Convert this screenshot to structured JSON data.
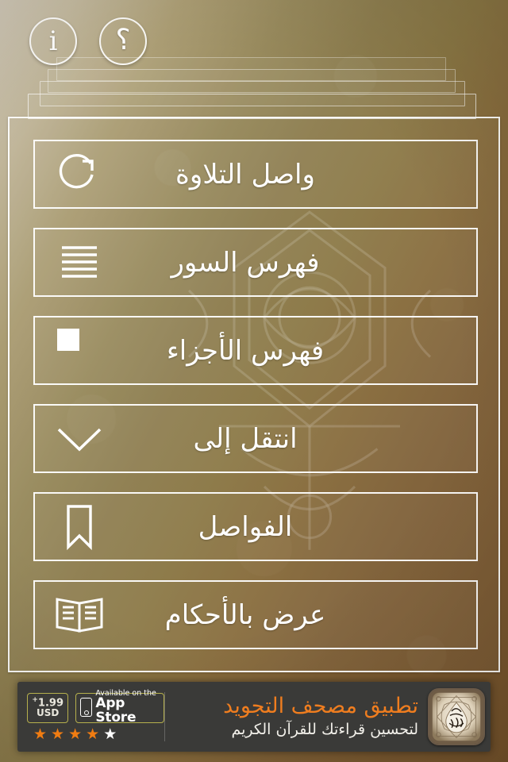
{
  "app": {
    "title": "مصحف التجويد",
    "accent_gold": "#8a7744",
    "accent_brown": "#75532b",
    "panel_border": "#ffffff"
  },
  "header": {
    "buttons": [
      {
        "id": "info",
        "name": "info-button",
        "glyph": "i",
        "label": "معلومات"
      },
      {
        "id": "help",
        "name": "help-button",
        "glyph": "؟",
        "label": "مساعدة"
      }
    ],
    "stack_layers": 4
  },
  "menu": {
    "items": [
      {
        "label": "واصل التلاوة",
        "icon": "refresh-icon"
      },
      {
        "label": "فهرس السور",
        "icon": "list-lines-icon"
      },
      {
        "label": "فهرس الأجزاء",
        "icon": "pie-chart-icon"
      },
      {
        "label": "انتقل إلى",
        "icon": "chevron-down-icon"
      },
      {
        "label": "الفواصل",
        "icon": "bookmark-icon"
      },
      {
        "label": "عرض بالأحكام",
        "icon": "open-book-icon"
      }
    ]
  },
  "ad": {
    "price_amount": "1.99",
    "price_plus": "+",
    "price_currency": "USD",
    "store_line1": "Available on the",
    "store_line2": "App Store",
    "rating_filled": 4,
    "rating_total": 5,
    "star_on_color": "#f07c12",
    "star_off_color": "#ffffff",
    "title": "تطبيق مصحف التجويد",
    "subtitle": "لتحسين قراءتك للقرآن الكريم",
    "title_color": "#ef7d1f",
    "app_icon": "quran-calligraphy-icon"
  }
}
